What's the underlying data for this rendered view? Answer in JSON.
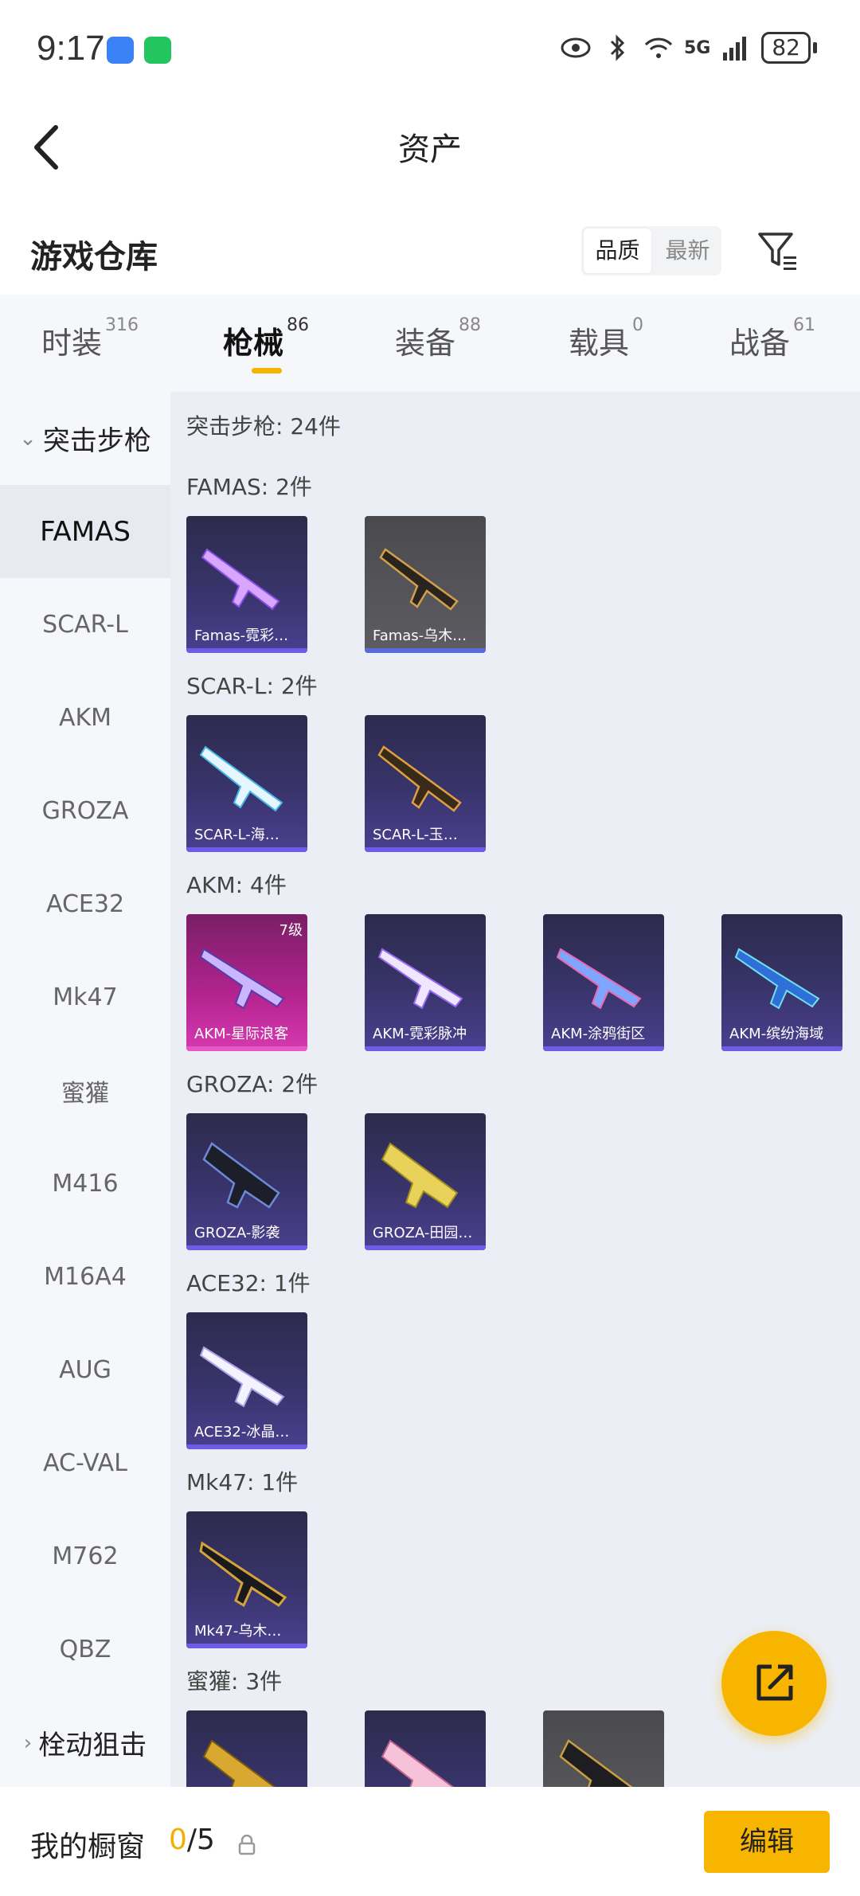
{
  "status_bar": {
    "time": "9:17",
    "network": "5G",
    "battery": "82"
  },
  "header": {
    "title": "资产"
  },
  "section": {
    "title": "游戏仓库",
    "sort_options": [
      "品质",
      "最新"
    ],
    "active_sort": "品质"
  },
  "tabs": [
    {
      "label": "时装",
      "count": "316"
    },
    {
      "label": "枪械",
      "count": "86"
    },
    {
      "label": "装备",
      "count": "88"
    },
    {
      "label": "载具",
      "count": "0"
    },
    {
      "label": "战备",
      "count": "61"
    }
  ],
  "active_tab": "枪械",
  "sidebar": {
    "group_open": "突击步枪",
    "items": [
      "FAMAS",
      "SCAR-L",
      "AKM",
      "GROZA",
      "ACE32",
      "Mk47",
      "蜜獾",
      "M416",
      "M16A4",
      "AUG",
      "AC-VAL",
      "M762",
      "QBZ"
    ],
    "active": "FAMAS",
    "group_next": "栓动狙击"
  },
  "content": {
    "summary": "突击步枪: 24件",
    "groups": [
      {
        "title": "FAMAS: 2件",
        "items": [
          {
            "label": "Famas-霓彩…",
            "style": "purple"
          },
          {
            "label": "Famas-乌木…",
            "style": "gray"
          }
        ]
      },
      {
        "title": "SCAR-L: 2件",
        "items": [
          {
            "label": "SCAR-L-海…",
            "style": "purple"
          },
          {
            "label": "SCAR-L-玉…",
            "style": "purple"
          }
        ]
      },
      {
        "title": "AKM: 4件",
        "items": [
          {
            "label": "AKM-星际浪客",
            "style": "pink",
            "badge": "7级"
          },
          {
            "label": "AKM-霓彩脉冲",
            "style": "purple"
          },
          {
            "label": "AKM-涂鸦街区",
            "style": "purple"
          },
          {
            "label": "AKM-缤纷海域",
            "style": "purple"
          }
        ]
      },
      {
        "title": "GROZA: 2件",
        "items": [
          {
            "label": "GROZA-影袭",
            "style": "purple"
          },
          {
            "label": "GROZA-田园…",
            "style": "purple"
          }
        ]
      },
      {
        "title": "ACE32: 1件",
        "items": [
          {
            "label": "ACE32-冰晶…",
            "style": "purple"
          }
        ]
      },
      {
        "title": "Mk47: 1件",
        "items": [
          {
            "label": "Mk47-乌木…",
            "style": "purple"
          }
        ]
      },
      {
        "title": "蜜獾: 3件",
        "items": [
          {
            "label": "",
            "style": "purple"
          },
          {
            "label": "",
            "style": "purple"
          },
          {
            "label": "",
            "style": "gray"
          }
        ]
      }
    ]
  },
  "bottom_bar": {
    "label": "我的橱窗",
    "current": "0",
    "total": "/5",
    "edit_label": "编辑"
  },
  "colors": {
    "accent": "#f7b500",
    "card_purple": "#38346b",
    "card_pink": "#b4248f",
    "card_gray": "#5c5c62"
  }
}
